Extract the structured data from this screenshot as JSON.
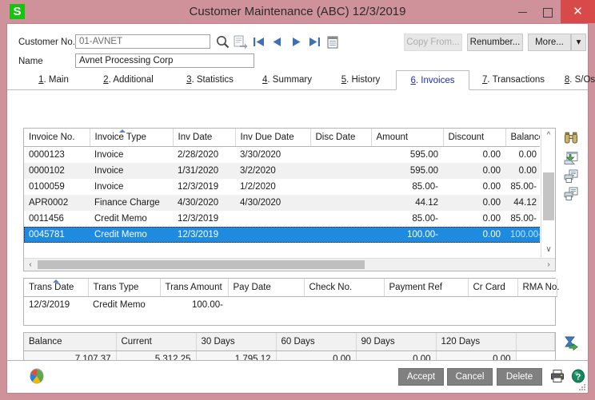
{
  "window": {
    "title": "Customer Maintenance (ABC) 12/3/2019",
    "logo_letter": "S",
    "logo_color": "#14c40e",
    "titlebar_color": "#cf929a",
    "close_color": "#d84a4a",
    "minimize_label": "Minimize",
    "maximize_label": "Maximize",
    "close_label": "Close"
  },
  "header": {
    "customer_no_label": "Customer No.",
    "customer_no_value": "01-AVNET",
    "name_label": "Name",
    "name_value": "Avnet Processing Corp",
    "toolbar_icons": [
      "lookup-icon",
      "next-number-icon",
      "nav-first-icon",
      "nav-prev-icon",
      "nav-next-icon",
      "nav-last-icon",
      "memo-icon"
    ],
    "buttons": {
      "copy_from": "Copy From...",
      "copy_from_enabled": false,
      "renumber": "Renumber...",
      "more": "More...",
      "more_dropdown": "▾"
    }
  },
  "tabs": {
    "active_index": 5,
    "items": [
      {
        "num": "1",
        "label": "Main"
      },
      {
        "num": "2",
        "label": "Additional"
      },
      {
        "num": "3",
        "label": "Statistics"
      },
      {
        "num": "4",
        "label": "Summary"
      },
      {
        "num": "5",
        "label": "History"
      },
      {
        "num": "6",
        "label": "Invoices"
      },
      {
        "num": "7",
        "label": "Transactions"
      },
      {
        "num": "8",
        "label": "S/Os"
      }
    ]
  },
  "invoice_grid": {
    "columns": [
      "Invoice No.",
      "Invoice Type",
      "Inv Date",
      "Inv Due Date",
      "Disc Date",
      "Amount",
      "Discount",
      "Balance"
    ],
    "sorted_column_index": 1,
    "selected_row_index": 5,
    "rows": [
      {
        "invoice_no": "0000123",
        "invoice_type": "Invoice",
        "inv_date": "2/28/2020",
        "inv_due_date": "3/30/2020",
        "disc_date": "",
        "amount": "595.00",
        "amount_neg": false,
        "discount": "0.00",
        "balance": "0.00",
        "balance_neg": false
      },
      {
        "invoice_no": "0000102",
        "invoice_type": "Invoice",
        "inv_date": "1/31/2020",
        "inv_due_date": "3/2/2020",
        "disc_date": "",
        "amount": "595.00",
        "amount_neg": false,
        "discount": "0.00",
        "balance": "0.00",
        "balance_neg": false
      },
      {
        "invoice_no": "0100059",
        "invoice_type": "Invoice",
        "inv_date": "12/3/2019",
        "inv_due_date": "1/2/2020",
        "disc_date": "",
        "amount": "85.00-",
        "amount_neg": true,
        "discount": "0.00",
        "balance": "85.00-",
        "balance_neg": true
      },
      {
        "invoice_no": "APR0002",
        "invoice_type": "Finance Charge",
        "inv_date": "4/30/2020",
        "inv_due_date": "4/30/2020",
        "disc_date": "",
        "amount": "44.12",
        "amount_neg": false,
        "discount": "0.00",
        "balance": "44.12",
        "balance_neg": false
      },
      {
        "invoice_no": "0011456",
        "invoice_type": "Credit Memo",
        "inv_date": "12/3/2019",
        "inv_due_date": "",
        "disc_date": "",
        "amount": "85.00-",
        "amount_neg": false,
        "discount": "0.00",
        "balance": "85.00-",
        "balance_neg": true
      },
      {
        "invoice_no": "0045781",
        "invoice_type": "Credit Memo",
        "inv_date": "12/3/2019",
        "inv_due_date": "",
        "disc_date": "",
        "amount": "100.00-",
        "amount_neg": false,
        "discount": "0.00",
        "balance": "100.00-",
        "balance_neg": true
      }
    ]
  },
  "trans_grid": {
    "columns": [
      "Trans Date",
      "Trans Type",
      "Trans Amount",
      "Pay Date",
      "Check No.",
      "Payment Ref",
      "Cr Card",
      "RMA No."
    ],
    "sorted_column_index": 0,
    "rows": [
      {
        "trans_date": "12/3/2019",
        "trans_type": "Credit Memo",
        "trans_amount": "100.00-",
        "trans_amount_neg": true,
        "pay_date": "",
        "check_no": "",
        "payment_ref": "",
        "cr_card": "",
        "rma_no": ""
      }
    ]
  },
  "aging": {
    "columns": [
      "Balance",
      "Current",
      "30 Days",
      "60 Days",
      "90 Days",
      "120 Days"
    ],
    "values": [
      "7,107.37",
      "5,312.25",
      "1,795.12",
      "0.00",
      "0.00",
      "0.00"
    ]
  },
  "side_icons": [
    "binoculars-icon",
    "drill-down-icon",
    "print-preview-icon",
    "print-preview-alt-icon"
  ],
  "aging_side_icon": "export-to-excel-icon",
  "footer": {
    "accept": "Accept",
    "cancel": "Cancel",
    "delete": "Delete",
    "print_icon": "print-icon",
    "help_icon": "help-icon",
    "app_icon": "windows-logo-icon"
  },
  "colors": {
    "accent_selection": "#1e8ae0",
    "negative_value": "#e02020",
    "active_tab_text": "#1a2fb0",
    "row_alt": "#f1f1f1"
  }
}
